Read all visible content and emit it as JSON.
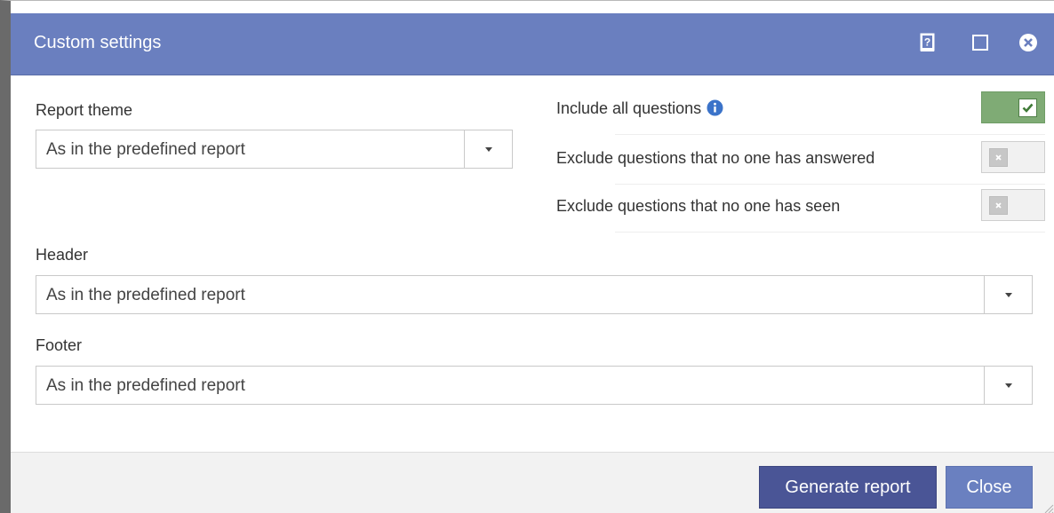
{
  "dialog": {
    "title": "Custom settings",
    "title_bar_color": "#6a7fbf",
    "icons": [
      "help-icon",
      "maximize-icon",
      "close-icon"
    ]
  },
  "report_theme": {
    "label": "Report theme",
    "value": "As in the predefined report"
  },
  "options": [
    {
      "label": "Include all questions",
      "enabled": true,
      "has_info_icon": true
    },
    {
      "label": "Exclude questions that no one has answered",
      "enabled": false
    },
    {
      "label": "Exclude questions that no one has seen",
      "enabled": false
    }
  ],
  "header": {
    "label": "Header",
    "value": "As in the predefined report"
  },
  "footer": {
    "label": "Footer",
    "value": "As in the predefined report"
  },
  "buttons": {
    "generate": "Generate report",
    "close": "Close"
  },
  "colors": {
    "toggle_on": "#7fab75",
    "generate_button": "#4a5596",
    "close_button": "#6a80c0"
  }
}
